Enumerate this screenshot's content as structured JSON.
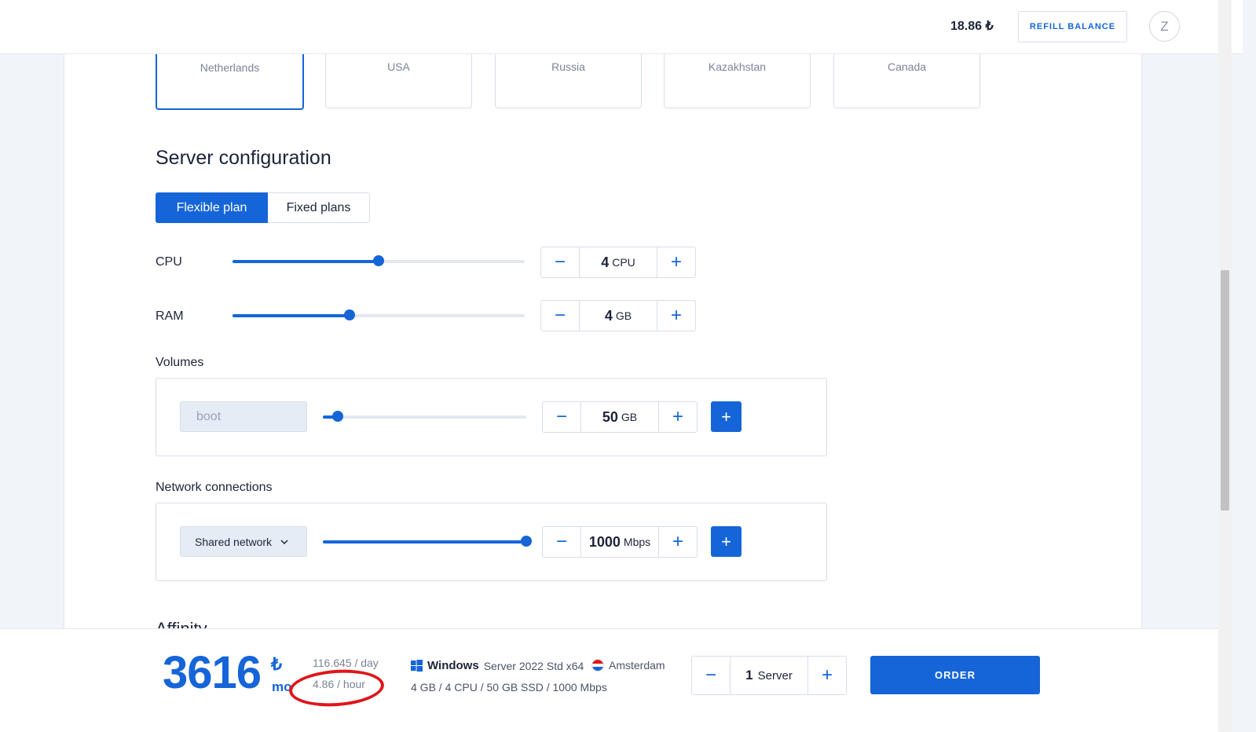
{
  "header": {
    "balance": "18.86 ₺",
    "refill_label": "REFILL BALANCE",
    "avatar_initial": "Z"
  },
  "locations": [
    {
      "name": "Netherlands",
      "selected": true
    },
    {
      "name": "USA",
      "selected": false
    },
    {
      "name": "Russia",
      "selected": false
    },
    {
      "name": "Kazakhstan",
      "selected": false
    },
    {
      "name": "Canada",
      "selected": false
    }
  ],
  "config": {
    "title": "Server configuration",
    "tabs": {
      "flexible": "Flexible plan",
      "fixed": "Fixed plans"
    },
    "cpu": {
      "label": "CPU",
      "value": "4",
      "unit": "CPU",
      "slider_fraction": 0.5
    },
    "ram": {
      "label": "RAM",
      "value": "4",
      "unit": "GB",
      "slider_fraction": 0.4
    },
    "volumes": {
      "label": "Volumes",
      "name": "boot",
      "value": "50",
      "unit": "GB",
      "slider_fraction": 0.075
    },
    "network": {
      "label": "Network connections",
      "type": "Shared network",
      "value": "1000",
      "unit": "Mbps",
      "slider_fraction": 1.0
    },
    "next_section_peek": "Affinity"
  },
  "summary": {
    "price": "3616",
    "currency": "₺",
    "period": "mo",
    "per_day": "116.645 / day",
    "per_hour": "4.86 / hour",
    "os_name": "Windows",
    "os_version": "Server 2022 Std x64",
    "city": "Amsterdam",
    "specs": "4 GB / 4 CPU / 50 GB SSD / 1000 Mbps",
    "server_count": "1",
    "server_unit": "Server",
    "order_label": "ORDER"
  },
  "icons": {
    "minus": "−",
    "plus": "+",
    "chevron": "chevron-down-icon"
  },
  "colors": {
    "accent": "#1565d8",
    "annotation": "#e0151a"
  }
}
